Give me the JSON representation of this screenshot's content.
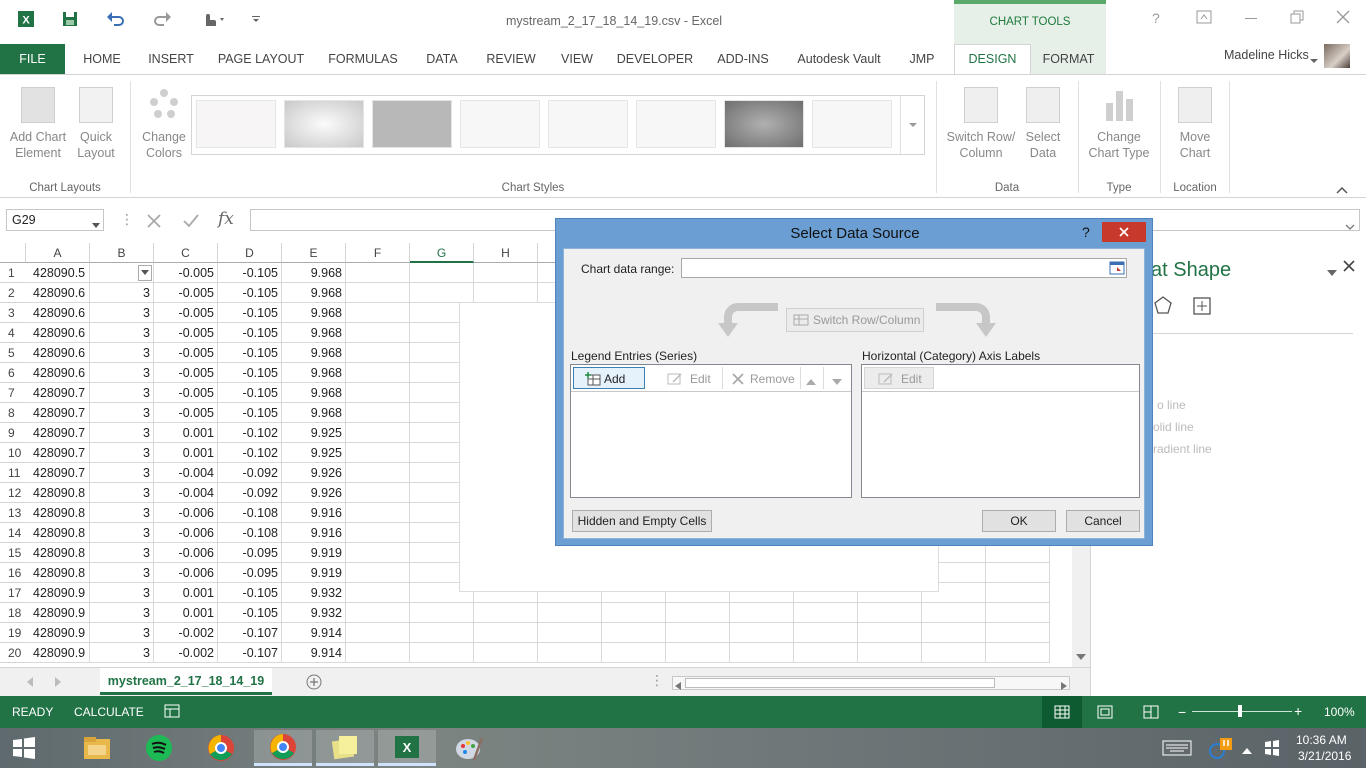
{
  "window": {
    "title": "mystream_2_17_18_14_19.csv - Excel",
    "chart_tools_label": "CHART TOOLS",
    "user_name": "Madeline Hicks",
    "help_glyph": "?"
  },
  "tabs": [
    "FILE",
    "HOME",
    "INSERT",
    "PAGE LAYOUT",
    "FORMULAS",
    "DATA",
    "REVIEW",
    "VIEW",
    "DEVELOPER",
    "ADD-INS",
    "Autodesk Vault",
    "JMP",
    "DESIGN",
    "FORMAT"
  ],
  "ribbon": {
    "add_chart_element": [
      "Add Chart",
      "Element"
    ],
    "quick_layout": [
      "Quick",
      "Layout"
    ],
    "change_colors": [
      "Change",
      "Colors"
    ],
    "switch_row_column": [
      "Switch Row/",
      "Column"
    ],
    "select_data": [
      "Select",
      "Data"
    ],
    "change_chart_type": [
      "Change",
      "Chart Type"
    ],
    "move_chart": [
      "Move",
      "Chart"
    ],
    "groups": {
      "chart_layouts": "Chart Layouts",
      "chart_styles": "Chart Styles",
      "data": "Data",
      "type": "Type",
      "location": "Location"
    }
  },
  "formula_bar": {
    "name_box": "G29",
    "fx": "fx",
    "value": ""
  },
  "grid": {
    "columns": [
      "A",
      "B",
      "C",
      "D",
      "E",
      "F",
      "G",
      "H"
    ],
    "rows": [
      [
        "428090.5",
        "",
        "-0.005",
        "-0.105",
        "9.968"
      ],
      [
        "428090.6",
        "3",
        "-0.005",
        "-0.105",
        "9.968"
      ],
      [
        "428090.6",
        "3",
        "-0.005",
        "-0.105",
        "9.968"
      ],
      [
        "428090.6",
        "3",
        "-0.005",
        "-0.105",
        "9.968"
      ],
      [
        "428090.6",
        "3",
        "-0.005",
        "-0.105",
        "9.968"
      ],
      [
        "428090.6",
        "3",
        "-0.005",
        "-0.105",
        "9.968"
      ],
      [
        "428090.7",
        "3",
        "-0.005",
        "-0.105",
        "9.968"
      ],
      [
        "428090.7",
        "3",
        "-0.005",
        "-0.105",
        "9.968"
      ],
      [
        "428090.7",
        "3",
        "0.001",
        "-0.102",
        "9.925"
      ],
      [
        "428090.7",
        "3",
        "0.001",
        "-0.102",
        "9.925"
      ],
      [
        "428090.7",
        "3",
        "-0.004",
        "-0.092",
        "9.926"
      ],
      [
        "428090.8",
        "3",
        "-0.004",
        "-0.092",
        "9.926"
      ],
      [
        "428090.8",
        "3",
        "-0.006",
        "-0.108",
        "9.916"
      ],
      [
        "428090.8",
        "3",
        "-0.006",
        "-0.108",
        "9.916"
      ],
      [
        "428090.8",
        "3",
        "-0.006",
        "-0.095",
        "9.919"
      ],
      [
        "428090.8",
        "3",
        "-0.006",
        "-0.095",
        "9.919"
      ],
      [
        "428090.9",
        "3",
        "0.001",
        "-0.105",
        "9.932"
      ],
      [
        "428090.9",
        "3",
        "0.001",
        "-0.105",
        "9.932"
      ],
      [
        "428090.9",
        "3",
        "-0.002",
        "-0.107",
        "9.914"
      ],
      [
        "428090.9",
        "3",
        "-0.002",
        "-0.107",
        "9.914"
      ]
    ]
  },
  "side_pane": {
    "title_fragment": "at Shape",
    "options": [
      "o line",
      "olid line",
      "radient line"
    ]
  },
  "dialog": {
    "title": "Select Data Source",
    "help": "?",
    "chart_data_range_label": "Chart data range:",
    "chart_data_range_value": "",
    "switch_row_column": "Switch Row/Column",
    "legend_entries_label": "Legend Entries (Series)",
    "axis_labels_label": "Horizontal (Category) Axis Labels",
    "add": "Add",
    "edit": "Edit",
    "remove": "Remove",
    "axis_edit": "Edit",
    "hidden_empty": "Hidden and Empty Cells",
    "ok": "OK",
    "cancel": "Cancel"
  },
  "sheet_tab": "mystream_2_17_18_14_19",
  "status": {
    "ready": "READY",
    "calculate": "CALCULATE",
    "zoom": "100%"
  },
  "taskbar": {
    "time": "10:36 AM",
    "date": "3/21/2016"
  },
  "colors": {
    "excel_green": "#217346",
    "dialog_frame": "#6b9ed2",
    "close_red": "#c7392b"
  }
}
